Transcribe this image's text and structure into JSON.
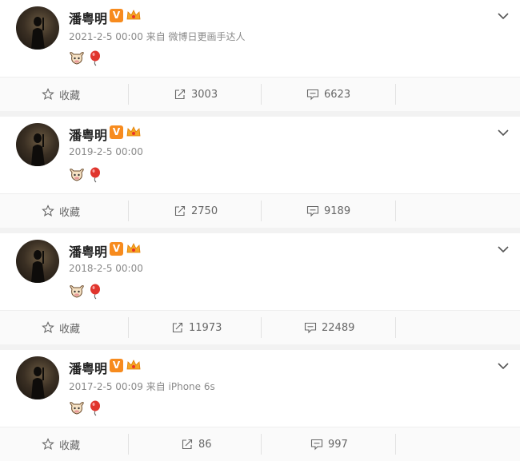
{
  "colors": {
    "verified_orange": "#f78b1e",
    "muted_text": "#8a8a8a",
    "action_text": "#666666"
  },
  "icons": {
    "favorite": "star-outline-icon",
    "repost": "repost-arrow-icon",
    "comment": "comment-bubble-icon",
    "expand": "chevron-down-icon"
  },
  "posts": [
    {
      "username": "潘粤明",
      "verified_mark": "V",
      "timestamp": "2021-2-5 00:00",
      "source": "来自 微博日更画手达人",
      "favorite_label": "收藏",
      "repost_count": "3003",
      "comment_count": "6623"
    },
    {
      "username": "潘粤明",
      "verified_mark": "V",
      "timestamp": "2019-2-5 00:00",
      "source": "",
      "favorite_label": "收藏",
      "repost_count": "2750",
      "comment_count": "9189"
    },
    {
      "username": "潘粤明",
      "verified_mark": "V",
      "timestamp": "2018-2-5 00:00",
      "source": "",
      "favorite_label": "收藏",
      "repost_count": "11973",
      "comment_count": "22489"
    },
    {
      "username": "潘粤明",
      "verified_mark": "V",
      "timestamp": "2017-2-5 00:09",
      "source": "来自 iPhone 6s",
      "favorite_label": "收藏",
      "repost_count": "86",
      "comment_count": "997"
    }
  ]
}
